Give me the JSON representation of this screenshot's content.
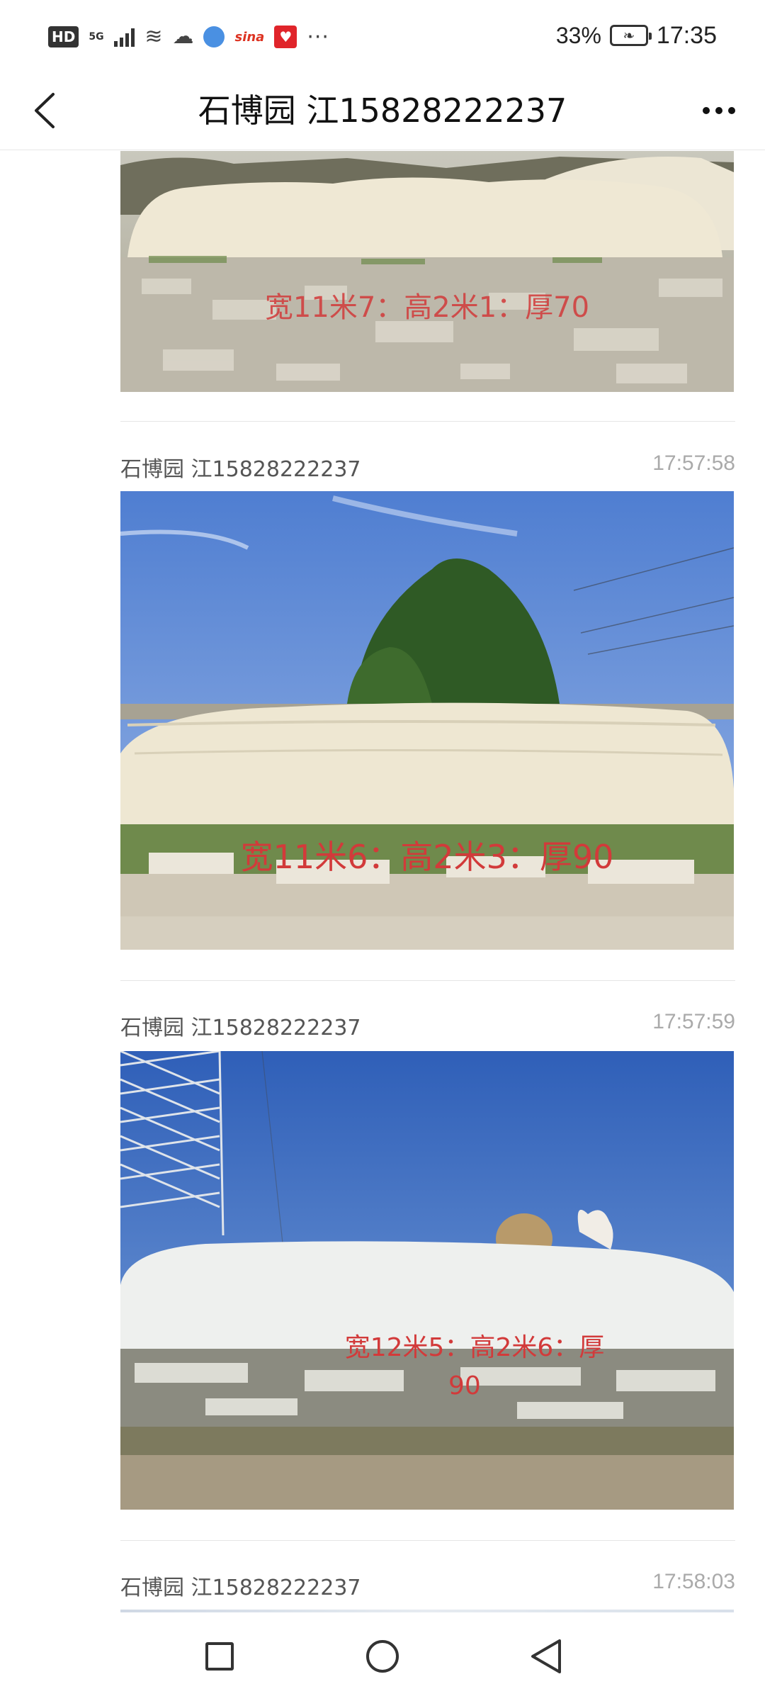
{
  "status_bar": {
    "hd": "HD",
    "network": "5G",
    "battery_percent": "33%",
    "time": "17:35",
    "icons": [
      "hd-icon",
      "signal-icon",
      "tap-icon",
      "wechat-icon",
      "browser-icon",
      "sina-icon",
      "app-icon",
      "more-dots-icon",
      "battery-icon"
    ]
  },
  "nav": {
    "title": "石博园 江15828222237",
    "back_icon": "chevron-left-icon",
    "more_icon": "more-horizontal-icon"
  },
  "messages": [
    {
      "sender": "",
      "time": "",
      "caption": "宽11米7：高2米1：厚70",
      "caption_lines": [
        "宽11米7：高2米1：厚70"
      ]
    },
    {
      "sender": "石博园 江15828222237",
      "time": "17:57:58",
      "caption": "宽11米6：高2米3：厚90",
      "caption_lines": [
        "宽11米6：高2米3：厚90"
      ]
    },
    {
      "sender": "石博园 江15828222237",
      "time": "17:57:59",
      "caption": "宽12米5：高2米6：厚90",
      "caption_lines": [
        "宽12米5：高2米6：厚",
        "90"
      ]
    },
    {
      "sender": "石博园 江15828222237",
      "time": "17:58:03",
      "caption": "",
      "caption_lines": []
    }
  ],
  "system_nav": {
    "icons": [
      "recent-apps-icon",
      "home-icon",
      "back-triangle-icon"
    ]
  },
  "colors": {
    "caption_red": "#d23a3a",
    "sender_gray": "#555555",
    "time_gray": "#aaaaaa",
    "divider": "#e5e5e5"
  }
}
